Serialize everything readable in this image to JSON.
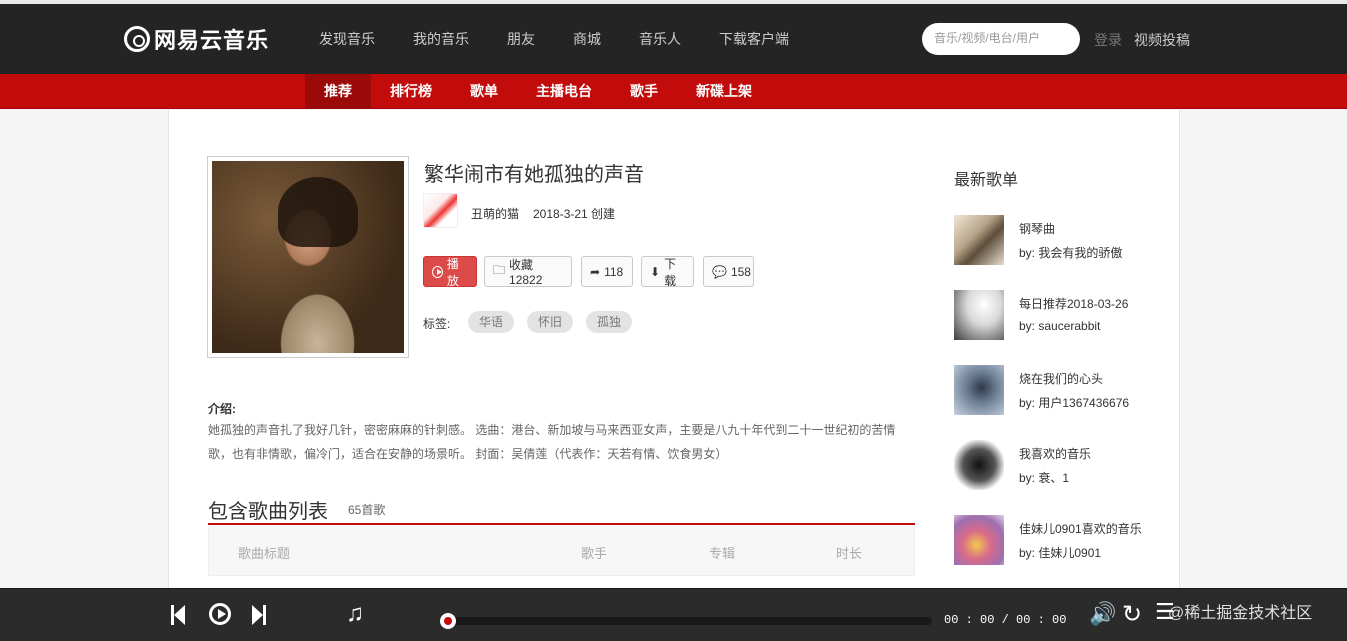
{
  "header": {
    "logo": "网易云音乐",
    "nav": [
      "发现音乐",
      "我的音乐",
      "朋友",
      "商城",
      "音乐人",
      "下载客户端"
    ],
    "search_placeholder": "音乐/视频/电台/用户",
    "login": "登录",
    "upload": "视频投稿"
  },
  "subnav": {
    "items": [
      "推荐",
      "排行榜",
      "歌单",
      "主播电台",
      "歌手",
      "新碟上架"
    ],
    "active_index": 0
  },
  "playlist": {
    "title": "繁华闹市有她孤独的声音",
    "creator": "丑萌的猫",
    "created": "2018-3-21 创建",
    "buttons": {
      "play": "播放",
      "favorite": "收藏12822",
      "share": "118",
      "download": "下载",
      "comment": "158"
    },
    "tags_label": "标签:",
    "tags": [
      "华语",
      "怀旧",
      "孤独"
    ],
    "intro_label": "介绍:",
    "intro_line1": "她孤独的声音扎了我好几针，密密麻麻的针刺感。 选曲：港台、新加坡与马来西亚女声，主要是八九十年代到二十一世纪初的苦情",
    "intro_line2": "歌，也有非情歌，偏冷门，适合在安静的场景听。 封面：吴倩莲（代表作：天若有情、饮食男女）"
  },
  "songs": {
    "title": "包含歌曲列表",
    "count": "65首歌",
    "columns": [
      "歌曲标题",
      "歌手",
      "专辑",
      "时长"
    ]
  },
  "sidebar": {
    "title": "最新歌单",
    "items": [
      {
        "name": "钢琴曲",
        "by": "by: 我会有我的骄傲"
      },
      {
        "name": "每日推荐2018-03-26",
        "by": "by: saucerabbit"
      },
      {
        "name": "烧在我们的心头",
        "by": "by: 用户1367436676"
      },
      {
        "name": "我喜欢的音乐",
        "by": "by: 衰、1"
      },
      {
        "name": "佳妹儿0901喜欢的音乐",
        "by": "by: 佳妹儿0901"
      }
    ]
  },
  "player": {
    "time": "00 : 00 / 00 : 00",
    "progress": 0,
    "watermark": "@稀土掘金技术社区"
  },
  "colors": {
    "brand_red": "#c20c0c",
    "topbar": "#242424",
    "player": "#2b2b2b"
  }
}
